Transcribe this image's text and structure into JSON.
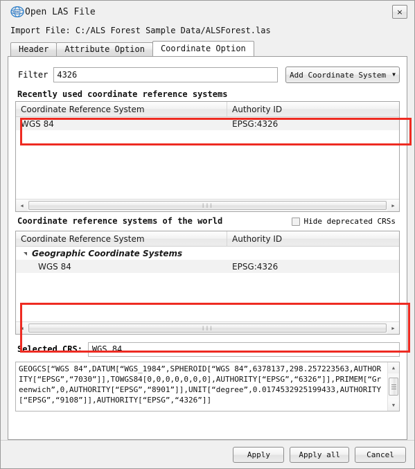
{
  "window": {
    "title": "Open LAS File",
    "logo_icon": "lidar360-globe-logo-icon",
    "close_icon": "close-icon",
    "close_label": "×"
  },
  "import": {
    "label": "Import File:",
    "path": "C:/ALS Forest Sample Data/ALSForest.las",
    "full_line": "Import File: C:/ALS Forest Sample Data/ALSForest.las"
  },
  "tabs": [
    {
      "label": "Header",
      "active": false
    },
    {
      "label": "Attribute Option",
      "active": false
    },
    {
      "label": "Coordinate Option",
      "active": true
    }
  ],
  "filter": {
    "label": "Filter",
    "value": "4326",
    "placeholder": "",
    "add_button_label": "Add Coordinate System",
    "add_button_caret_icon": "chevron-down-icon",
    "caret_glyph": "▼"
  },
  "recent": {
    "heading": "Recently used coordinate reference systems",
    "columns": [
      "Coordinate Reference System",
      "Authority ID"
    ],
    "rows": [
      {
        "name": "WGS 84",
        "authority": "EPSG:4326"
      }
    ],
    "hscroll": {
      "left_icon": "scroll-left-arrow-icon",
      "right_icon": "scroll-right-arrow-icon",
      "left_glyph": "◀",
      "right_glyph": "▶",
      "grip_glyph": "❘❘❘"
    }
  },
  "world": {
    "heading": "Coordinate reference systems of the world",
    "hide_deprecated_label": "Hide deprecated CRSs",
    "hide_deprecated_checked": false,
    "checkbox_icon": "checkbox-unchecked-icon",
    "columns": [
      "Coordinate Reference System",
      "Authority ID"
    ],
    "groups": [
      {
        "label": "Geographic Coordinate Systems",
        "expanded": true,
        "expander_icon": "tree-expanded-triangle-icon",
        "children": [
          {
            "name": "WGS 84",
            "authority": "EPSG:4326"
          }
        ]
      }
    ],
    "hscroll": {
      "left_icon": "scroll-left-arrow-icon",
      "right_icon": "scroll-right-arrow-icon",
      "left_glyph": "◀",
      "right_glyph": "▶",
      "grip_glyph": "❘❘❘"
    }
  },
  "selected_crs": {
    "label": "Selected CRS:",
    "value": "WGS 84"
  },
  "wkt": {
    "text": "GEOGCS[“WGS 84”,DATUM[“WGS_1984”,SPHEROID[“WGS 84”,6378137,298.257223563,AUTHORITY[“EPSG”,“7030”]],TOWGS84[0,0,0,0,0,0,0],AUTHORITY[“EPSG”,“6326”]],PRIMEM[“Greenwich”,0,AUTHORITY[“EPSG”,“8901”]],UNIT[“degree”,0.0174532925199433,AUTHORITY[“EPSG”,“9108”]],AUTHORITY[“EPSG”,“4326”]]",
    "scroll_up_icon": "scroll-up-arrow-icon",
    "scroll_down_icon": "scroll-down-arrow-icon",
    "up_glyph": "▲",
    "down_glyph": "▼"
  },
  "footer": {
    "apply_label": "Apply",
    "apply_all_label": "Apply all",
    "cancel_label": "Cancel"
  },
  "annotations": {
    "highlight_color": "#ee2b22",
    "boxes": [
      "filter-row-highlight",
      "world-crs-table-highlight"
    ]
  }
}
